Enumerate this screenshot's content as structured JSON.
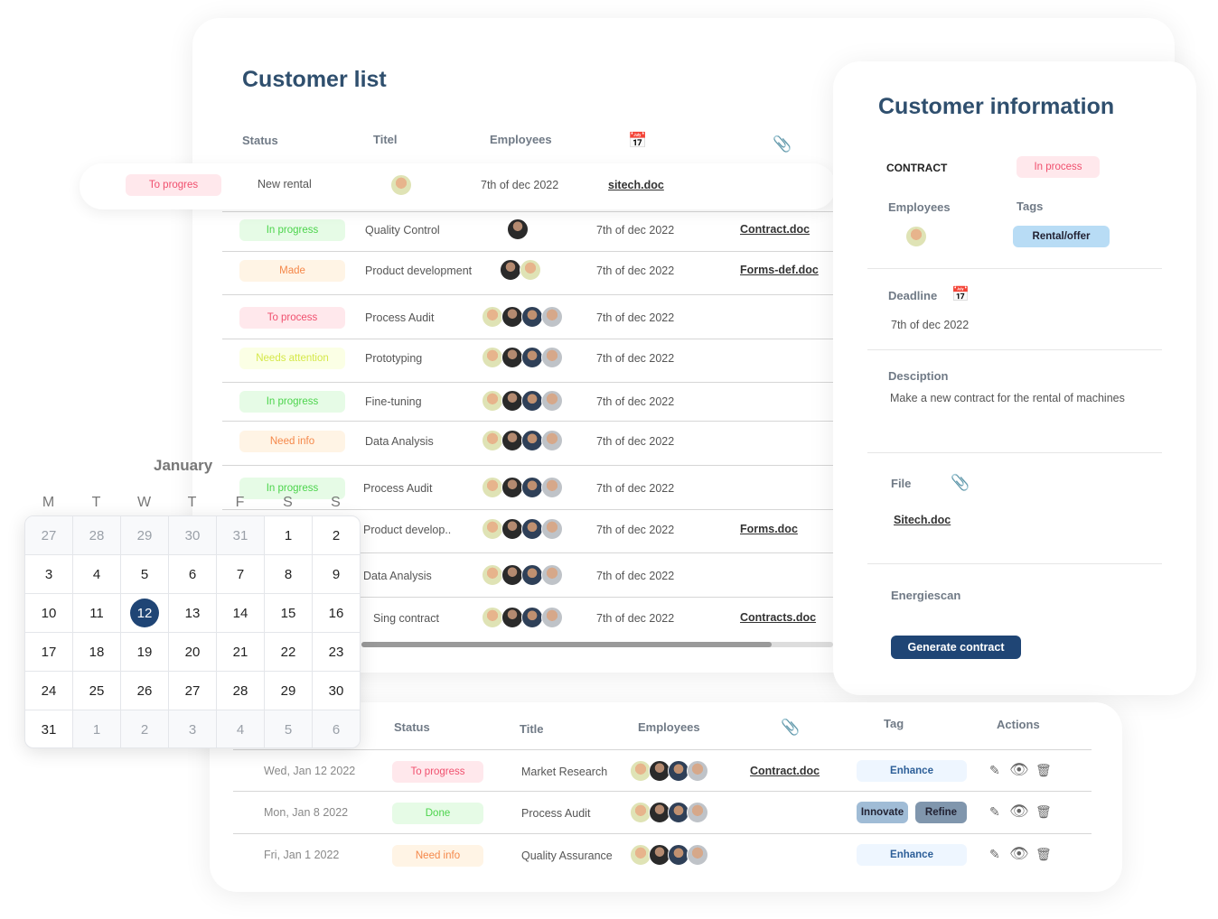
{
  "colors": {
    "title": "#2f4f6e",
    "primary_button": "#1f4575"
  },
  "customer_list": {
    "title": "Customer list",
    "headers": {
      "status": "Status",
      "title": "Titel",
      "employees": "Employees",
      "date_icon": "calendar-icon",
      "file_icon": "paperclip-icon"
    },
    "highlight_row": {
      "status": "To progres",
      "title": "New rental",
      "avatars": 1,
      "date": "7th of dec 2022",
      "file": "sitech.doc"
    },
    "rows": [
      {
        "status": "In progress",
        "tone": "green",
        "title": "Quality Control",
        "avatars": [
          "dark"
        ],
        "date": "7th of dec 2022",
        "file": "Contract.doc"
      },
      {
        "status": "Made",
        "tone": "orange",
        "title": "Product development",
        "avatars": [
          "dark",
          "light"
        ],
        "date": "7th of dec 2022",
        "file": "Forms-def.doc"
      },
      {
        "status": "To process",
        "tone": "red",
        "title": "Process Audit",
        "avatars": [
          "light",
          "dark",
          "navy",
          "grey"
        ],
        "date": "7th of dec 2022",
        "file": ""
      },
      {
        "status": "Needs attention",
        "tone": "yellow",
        "title": "Prototyping",
        "avatars": [
          "light",
          "dark",
          "navy",
          "grey"
        ],
        "date": "7th of dec 2022",
        "file": ""
      },
      {
        "status": "In progress",
        "tone": "green",
        "title": "Fine-tuning",
        "avatars": [
          "light",
          "dark",
          "navy",
          "grey"
        ],
        "date": "7th of dec 2022",
        "file": ""
      },
      {
        "status": "Need info",
        "tone": "orange",
        "title": "Data Analysis",
        "avatars": [
          "light",
          "dark",
          "navy",
          "grey"
        ],
        "date": "7th of dec 2022",
        "file": ""
      },
      {
        "status": "In progress",
        "tone": "green",
        "title": "Process Audit",
        "avatars": [
          "light",
          "dark",
          "navy",
          "grey"
        ],
        "date": "7th of dec 2022",
        "file": ""
      },
      {
        "status": "",
        "tone": "none",
        "title": "Product develop..",
        "avatars": [
          "light",
          "dark",
          "navy",
          "grey"
        ],
        "date": "7th of dec 2022",
        "file": "Forms.doc"
      },
      {
        "status": "",
        "tone": "none",
        "title": "Data  Analysis",
        "avatars": [
          "light",
          "dark",
          "navy",
          "grey"
        ],
        "date": "7th of dec 2022",
        "file": ""
      },
      {
        "status": "",
        "tone": "none",
        "title": "Sing contract",
        "avatars": [
          "light",
          "dark",
          "navy",
          "grey"
        ],
        "date": "7th of dec 2022",
        "file": "Contracts.doc"
      }
    ],
    "scroll_fraction": 0.87
  },
  "customer_info": {
    "title": "Customer information",
    "contract_label": "CONTRACT",
    "contract_status": "In process",
    "employees_label": "Employees",
    "tags_label": "Tags",
    "tag": "Rental/offer",
    "deadline_label": "Deadline",
    "deadline": "7th of dec 2022",
    "description_label": "Desciption",
    "description": "Make a new contract for the rental of machines",
    "file_label": "File",
    "file": "Sitech.doc",
    "energiescan_label": "Energiescan",
    "button": "Generate contract"
  },
  "calendar": {
    "month": "January",
    "weekdays": [
      "M",
      "T",
      "W",
      "T",
      "F",
      "S",
      "S"
    ],
    "weeks": [
      [
        27,
        28,
        29,
        30,
        31,
        1,
        2
      ],
      [
        3,
        4,
        5,
        6,
        7,
        8,
        9
      ],
      [
        10,
        11,
        12,
        13,
        14,
        15,
        16
      ],
      [
        17,
        18,
        19,
        20,
        21,
        22,
        23
      ],
      [
        24,
        25,
        26,
        27,
        28,
        29,
        30
      ],
      [
        31,
        1,
        2,
        3,
        4,
        5,
        6
      ]
    ],
    "selected": 12
  },
  "bottom_table": {
    "headers": {
      "status": "Status",
      "title": "Title",
      "employees": "Employees",
      "file_icon": "paperclip-icon",
      "tag": "Tag",
      "actions": "Actions"
    },
    "rows": [
      {
        "date": "Wed, Jan 12 2022",
        "status": "To progress",
        "tone": "red",
        "title": "Market Research",
        "file": "Contract.doc",
        "tags": [
          {
            "label": "Enhance",
            "style": "light"
          }
        ]
      },
      {
        "date": "Mon, Jan 8 2022",
        "status": "Done",
        "tone": "green",
        "title": "Process Audit",
        "file": "",
        "tags": [
          {
            "label": "Innovate",
            "style": "mid"
          },
          {
            "label": "Refine",
            "style": "dark"
          }
        ]
      },
      {
        "date": "Fri, Jan 1 2022",
        "status": "Need info",
        "tone": "orange",
        "title": "Quality Assurance",
        "file": "",
        "tags": [
          {
            "label": "Enhance",
            "style": "light"
          }
        ]
      }
    ]
  }
}
